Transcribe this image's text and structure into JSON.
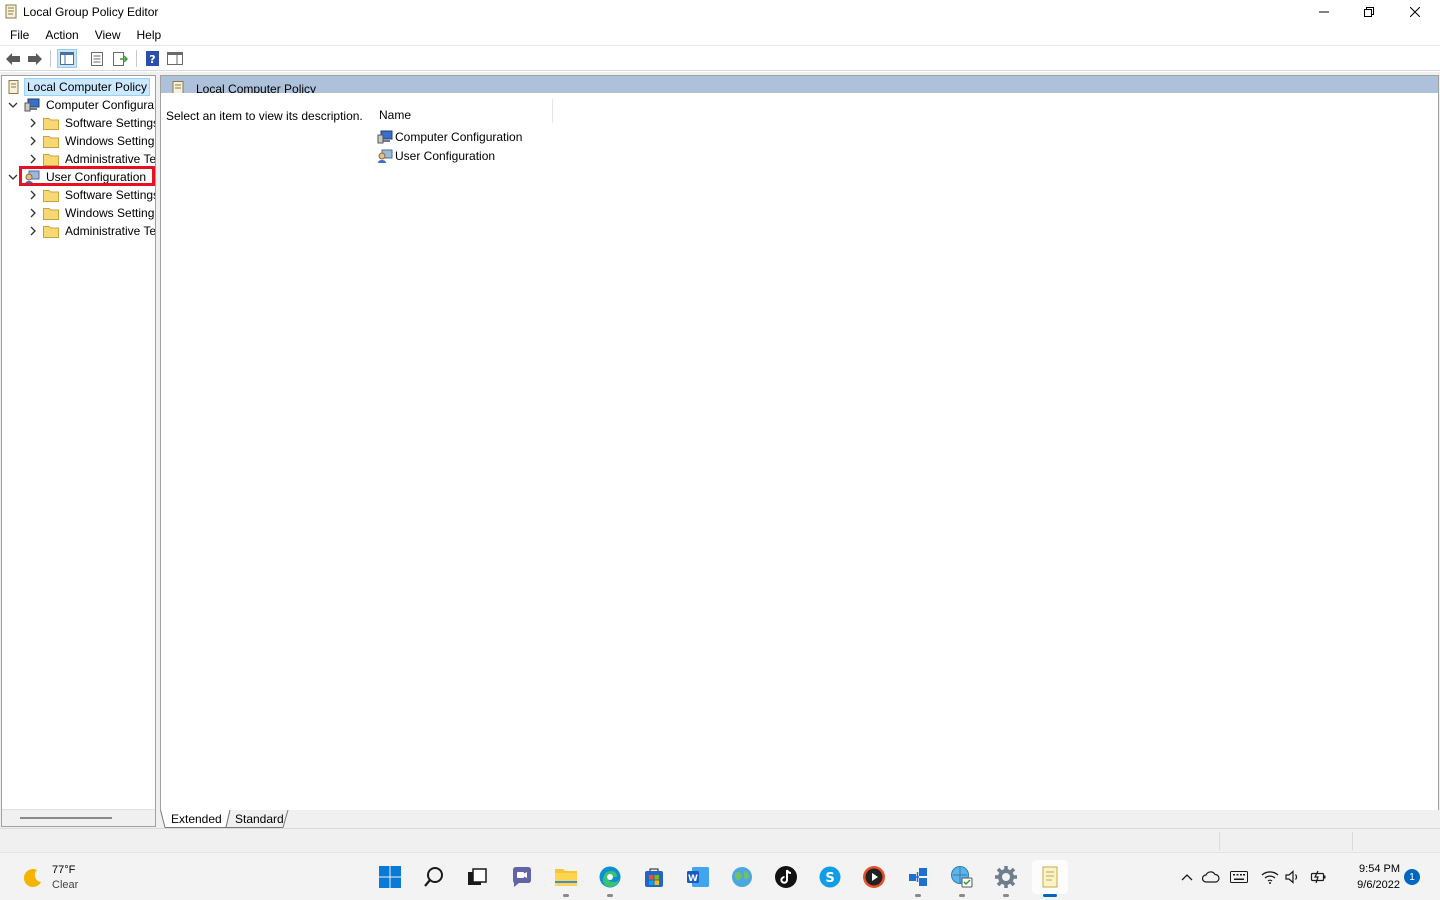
{
  "window": {
    "title": "Local Group Policy Editor"
  },
  "menubar": {
    "items": [
      "File",
      "Action",
      "View",
      "Help"
    ]
  },
  "tree": {
    "root": "Local Computer Policy",
    "nodes": [
      {
        "label": "Computer Configura",
        "level": 1,
        "expanded": true
      },
      {
        "label": "Software Settings",
        "level": 2
      },
      {
        "label": "Windows Setting",
        "level": 2
      },
      {
        "label": "Administrative Te",
        "level": 2
      },
      {
        "label": "User Configuration",
        "level": 1,
        "expanded": true,
        "highlighted": true
      },
      {
        "label": "Software Settings",
        "level": 2
      },
      {
        "label": "Windows Setting",
        "level": 2
      },
      {
        "label": "Administrative Te",
        "level": 2
      }
    ]
  },
  "right_pane": {
    "header_title": "Local Computer Policy",
    "description": "Select an item to view its description.",
    "column_name": "Name",
    "items": [
      "Computer Configuration",
      "User Configuration"
    ]
  },
  "bottom_tabs": [
    "Extended",
    "Standard"
  ],
  "taskbar": {
    "weather_temp": "77°F",
    "weather_cond": "Clear",
    "time": "9:54 PM",
    "date": "9/6/2022",
    "notification_count": "1"
  },
  "colors": {
    "highlight_box": "#e81123",
    "header_bar": "#adc1db",
    "accent": "#0067c0"
  }
}
